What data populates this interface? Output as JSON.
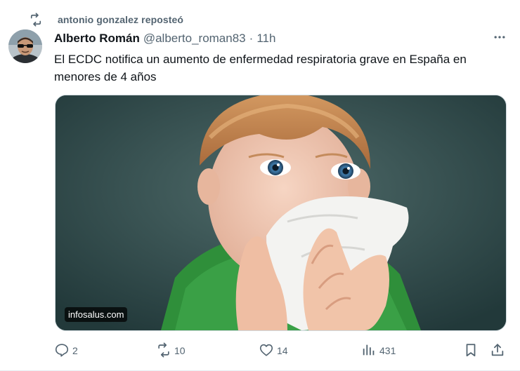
{
  "repost": {
    "label": "antonio gonzalez reposteó",
    "icon": "repost-icon"
  },
  "author": {
    "name": "Alberto Román",
    "handle": "@alberto_roman83",
    "separator": "·",
    "time": "11h"
  },
  "tweet": {
    "text": "El ECDC notifica un aumento de enfermedad respiratoria grave en España en menores de 4 años"
  },
  "media": {
    "source_label": "infosalus.com"
  },
  "actions": {
    "reply_count": "2",
    "repost_count": "10",
    "like_count": "14",
    "views_count": "431"
  },
  "icons": {
    "more": "more-icon",
    "reply": "reply-icon",
    "repost": "repost-icon",
    "like": "heart-icon",
    "views": "views-icon",
    "bookmark": "bookmark-icon",
    "share": "share-icon"
  },
  "colors": {
    "text_primary": "#0f1419",
    "text_secondary": "#536471",
    "border": "#cfd9de"
  }
}
